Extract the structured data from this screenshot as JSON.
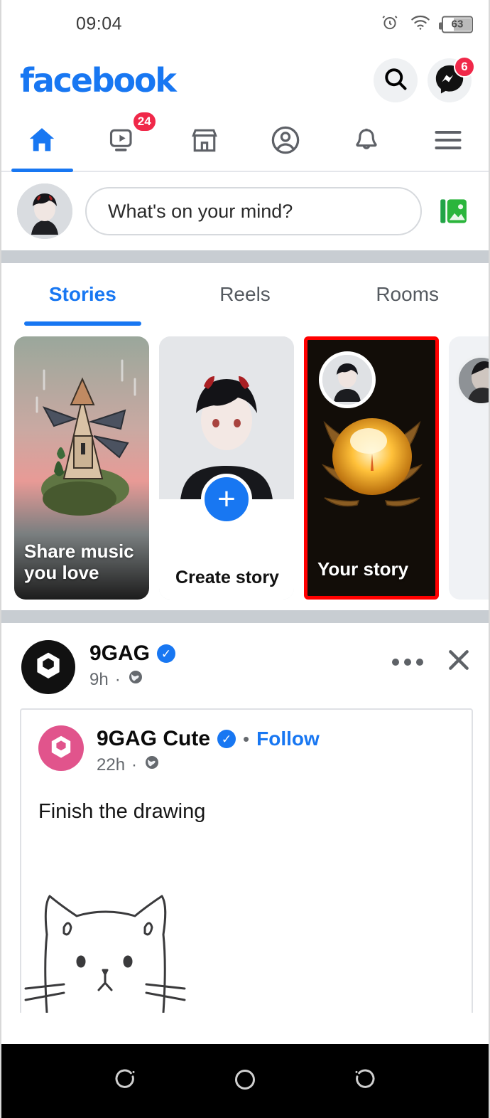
{
  "status_bar": {
    "time": "09:04",
    "alarm_icon": "alarm-icon",
    "wifi_icon": "wifi-icon",
    "battery_level": "63"
  },
  "header": {
    "logo_text": "facebook",
    "logo_color": "#1877F2",
    "search_icon": "search-icon",
    "messenger_icon": "messenger-icon",
    "messenger_badge": "6"
  },
  "nav_tabs": [
    {
      "name": "home",
      "icon": "home-icon",
      "active": true,
      "badge": ""
    },
    {
      "name": "watch",
      "icon": "video-icon",
      "active": false,
      "badge": "24"
    },
    {
      "name": "marketplace",
      "icon": "store-icon",
      "active": false,
      "badge": ""
    },
    {
      "name": "profile",
      "icon": "person-circle-icon",
      "active": false,
      "badge": ""
    },
    {
      "name": "notifications",
      "icon": "bell-icon",
      "active": false,
      "badge": ""
    },
    {
      "name": "menu",
      "icon": "hamburger-menu-icon",
      "active": false,
      "badge": ""
    }
  ],
  "composer": {
    "avatar": "user-avatar",
    "placeholder": "What's on your mind?",
    "photo_icon": "photo-library-icon"
  },
  "stories_tabs": [
    {
      "label": "Stories",
      "active": true
    },
    {
      "label": "Reels",
      "active": false
    },
    {
      "label": "Rooms",
      "active": false
    }
  ],
  "stories": [
    {
      "label": "Share music\nyou love",
      "type": "promo",
      "highlighted": false
    },
    {
      "label": "Create story",
      "type": "create",
      "highlighted": false
    },
    {
      "label": "Your story",
      "type": "own",
      "highlighted": true
    }
  ],
  "story_highlight_color": "#FF0000",
  "post": {
    "page_name": "9GAG",
    "verified": true,
    "time": "9h",
    "audience_icon": "globe-icon",
    "more_icon": "more-options-icon",
    "close_icon": "close-icon",
    "shared": {
      "page_name": "9GAG Cute",
      "verified": true,
      "separator": "•",
      "follow_label": "Follow",
      "time": "22h",
      "audience_icon": "globe-icon",
      "text": "Finish the drawing",
      "image_alt": "cat-line-drawing"
    }
  },
  "android_nav": [
    {
      "name": "recents",
      "icon": "recents-icon"
    },
    {
      "name": "home",
      "icon": "home-circle-icon"
    },
    {
      "name": "back",
      "icon": "back-icon"
    }
  ]
}
